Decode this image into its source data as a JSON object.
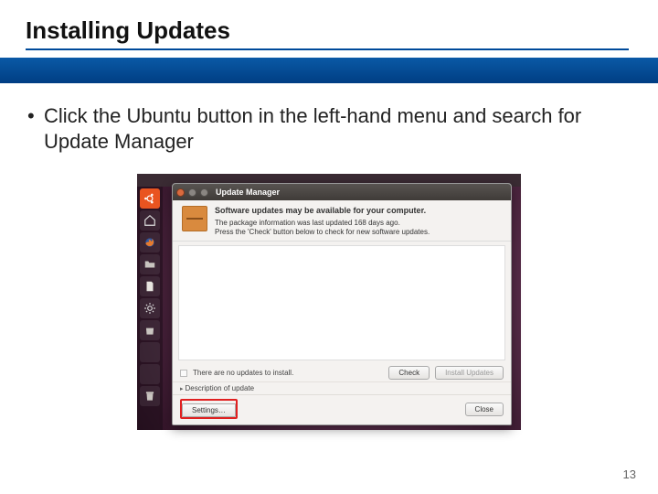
{
  "slide": {
    "title": "Installing Updates",
    "bullet": "Click the Ubuntu button in the left-hand menu and search for Update Manager",
    "page_number": "13"
  },
  "screenshot": {
    "launcher_icons": [
      "ubuntu",
      "home",
      "firefox",
      "folder",
      "document",
      "settings",
      "software",
      "terminal",
      "trash"
    ],
    "window": {
      "title": "Update Manager",
      "heading": "Software updates may be available for your computer.",
      "sub1": "The package information was last updated 168 days ago.",
      "sub2": "Press the 'Check' button below to check for new software updates.",
      "status": "There are no updates to install.",
      "check_btn": "Check",
      "install_btn": "Install Updates",
      "description_toggle": "Description of update",
      "settings_btn": "Settings…",
      "close_btn": "Close"
    }
  }
}
